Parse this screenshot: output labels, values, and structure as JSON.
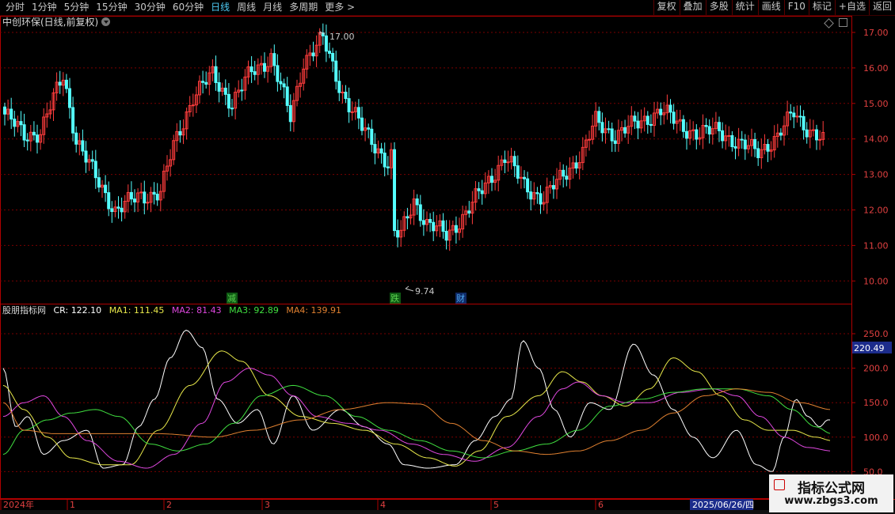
{
  "tabs": [
    {
      "label": "分时",
      "active": false
    },
    {
      "label": "1分钟",
      "active": false
    },
    {
      "label": "5分钟",
      "active": false
    },
    {
      "label": "15分钟",
      "active": false
    },
    {
      "label": "30分钟",
      "active": false
    },
    {
      "label": "60分钟",
      "active": false
    },
    {
      "label": "日线",
      "active": true
    },
    {
      "label": "周线",
      "active": false
    },
    {
      "label": "月线",
      "active": false
    },
    {
      "label": "多周期",
      "active": false
    },
    {
      "label": "更多 >",
      "active": false
    }
  ],
  "toolbar": [
    "复权",
    "叠加",
    "多股",
    "统计",
    "画线",
    "F10",
    "标记",
    "+自选",
    "返回"
  ],
  "stock": {
    "title": "中创环保(日线,前复权)"
  },
  "price_axis": {
    "labels": [
      "17.00",
      "16.00",
      "15.00",
      "14.00",
      "13.00",
      "12.00",
      "11.00",
      "10.00"
    ]
  },
  "annotations": {
    "high": "17.00",
    "low": "9.74"
  },
  "events": [
    {
      "label": "减",
      "color": "#5bd14f"
    },
    {
      "label": "跌",
      "color": "#5bd14f"
    },
    {
      "label": "财",
      "color": "#4ea8f0"
    }
  ],
  "indicator": {
    "name": "股朋指标网",
    "cr": "CR: 122.10",
    "ma1": "MA1: 111.45",
    "ma2": "MA2: 81.43",
    "ma3": "MA3: 92.89",
    "ma4": "MA4: 139.91",
    "axis_labels": [
      "250.0",
      "200.0",
      "150.0",
      "100.0",
      "50.0"
    ],
    "current_value": "220.49",
    "colors": {
      "cr": "#ffffff",
      "ma1": "#e8e84a",
      "ma2": "#e048e0",
      "ma3": "#40e040",
      "ma4": "#e08030"
    }
  },
  "date_axis": {
    "labels": [
      "2024年",
      "1",
      "2",
      "3",
      "4",
      "5",
      "6"
    ],
    "selected_date": "2025/06/26/四"
  },
  "watermark": {
    "title": "指标公式网",
    "url": "www.zbgs3.com"
  },
  "colors": {
    "up": "#ff3c3c",
    "down": "#54ffff",
    "grid": "#7a0000",
    "frame": "#b00000",
    "active_tab": "#4ecbf5"
  }
}
